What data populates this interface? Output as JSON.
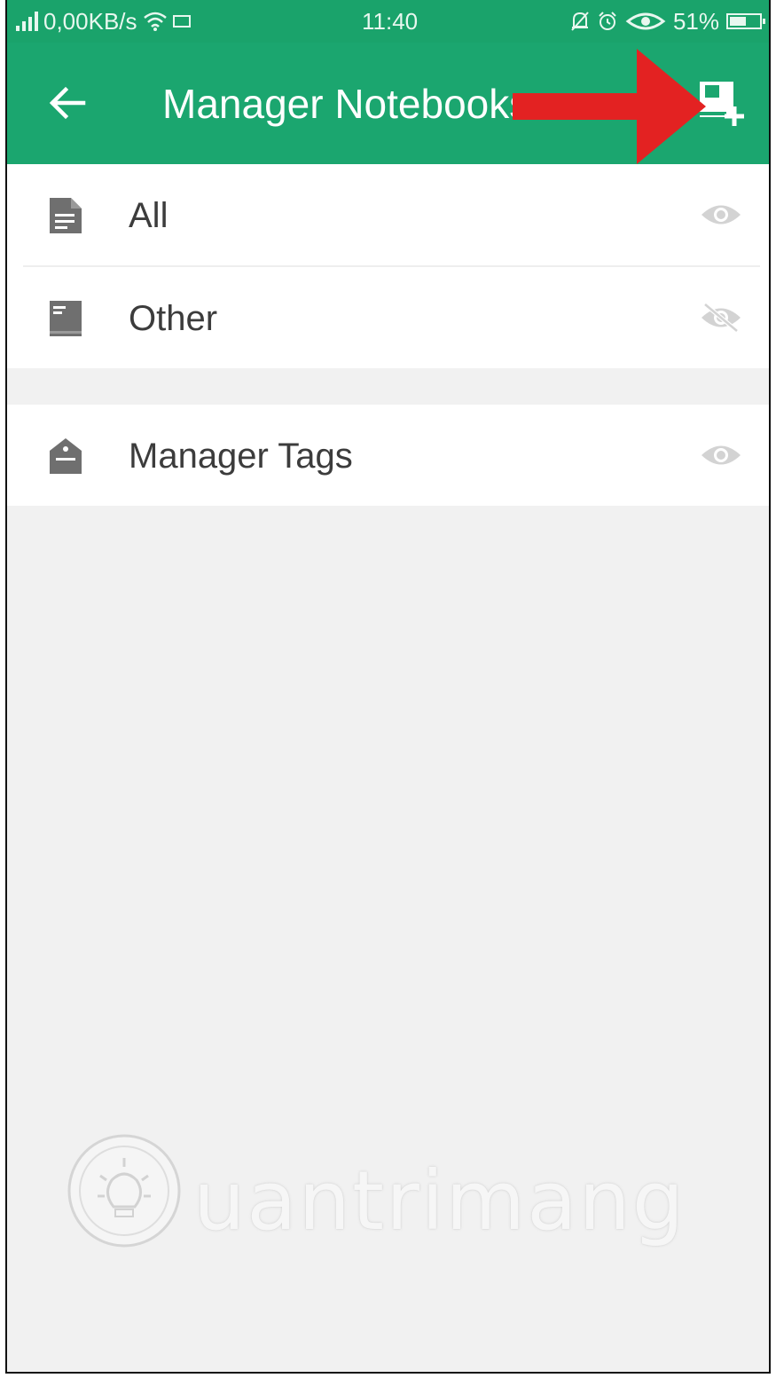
{
  "status_bar": {
    "network_speed": "0,00KB/s",
    "time": "11:40",
    "battery": "51%"
  },
  "app_bar": {
    "title": "Manager Notebooks",
    "back_icon": "arrow-left-icon",
    "action_icon": "add-notebook-icon"
  },
  "notebooks": [
    {
      "label": "All",
      "icon": "note-icon",
      "visibility": "visible"
    },
    {
      "label": "Other",
      "icon": "notebook-icon",
      "visibility": "hidden"
    }
  ],
  "tags": {
    "label": "Manager Tags",
    "icon": "tag-icon",
    "visibility": "visible"
  },
  "watermark": {
    "text": "uantrimang"
  },
  "colors": {
    "primary": "#1ba66f",
    "status_bar": "#1aa36b",
    "arrow": "#e32222",
    "icon_gray": "#6f6f6f",
    "eye_gray": "#cfcfcf"
  }
}
